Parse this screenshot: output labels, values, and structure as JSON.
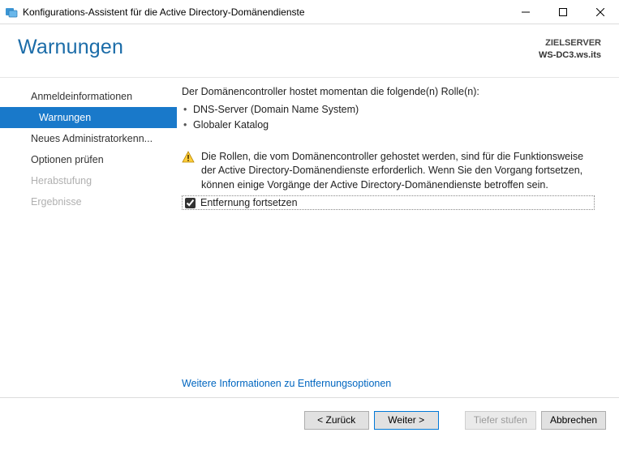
{
  "window": {
    "title": "Konfigurations-Assistent für die Active Directory-Domänendienste"
  },
  "header": {
    "page_title": "Warnungen",
    "target_label": "ZIELSERVER",
    "target_value": "WS-DC3.ws.its"
  },
  "sidebar": {
    "items": [
      {
        "label": "Anmeldeinformationen",
        "state": "normal"
      },
      {
        "label": "Warnungen",
        "state": "selected"
      },
      {
        "label": "Neues Administratorkenn...",
        "state": "normal"
      },
      {
        "label": "Optionen prüfen",
        "state": "normal"
      },
      {
        "label": "Herabstufung",
        "state": "disabled"
      },
      {
        "label": "Ergebnisse",
        "state": "disabled"
      }
    ]
  },
  "content": {
    "intro": "Der Domänencontroller hostet momentan die folgende(n) Rolle(n):",
    "roles": [
      "DNS-Server (Domain Name System)",
      "Globaler Katalog"
    ],
    "warning_text": "Die Rollen, die vom Domänencontroller gehostet werden, sind für die Funktionsweise der Active Directory-Domänendienste erforderlich. Wenn Sie den Vorgang fortsetzen, können einige Vorgänge der Active Directory-Domänendienste betroffen sein.",
    "checkbox_label": "Entfernung fortsetzen",
    "checkbox_checked": true,
    "more_link": "Weitere Informationen zu Entfernungsoptionen"
  },
  "footer": {
    "back": "< Zurück",
    "next": "Weiter >",
    "demote": "Tiefer stufen",
    "cancel": "Abbrechen"
  }
}
